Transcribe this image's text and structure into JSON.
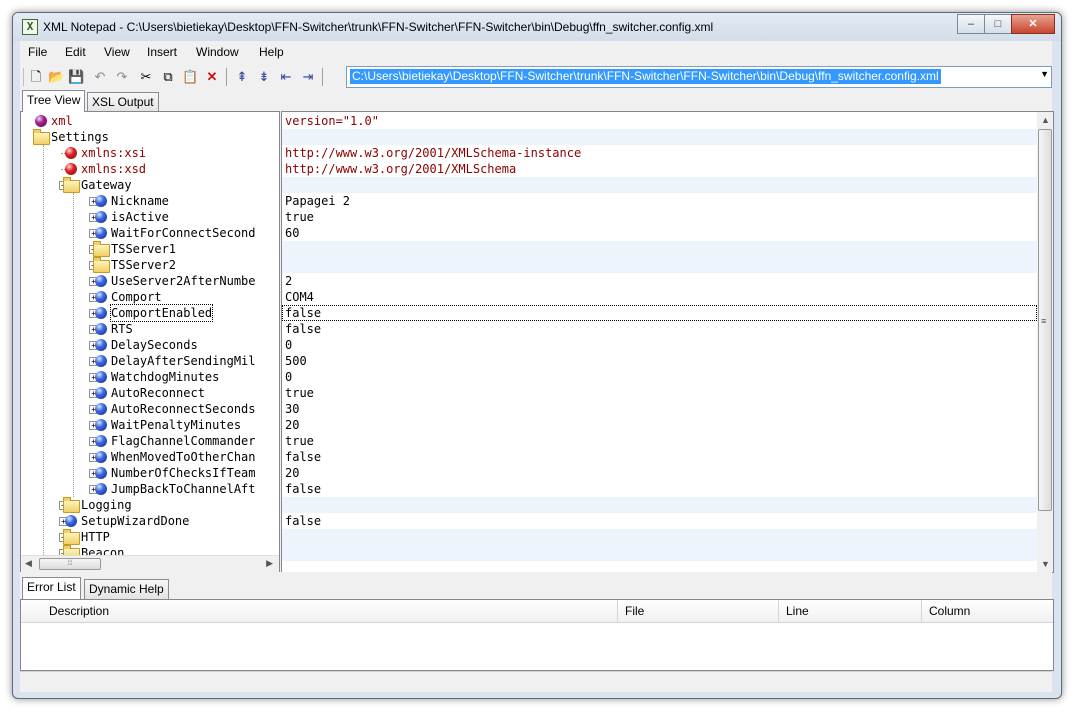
{
  "window": {
    "title": "XML Notepad - C:\\Users\\bietiekay\\Desktop\\FFN-Switcher\\trunk\\FFN-Switcher\\FFN-Switcher\\bin\\Debug\\ffn_switcher.config.xml",
    "app_icon": "X",
    "minimize": "–",
    "maximize": "□",
    "close": "✕"
  },
  "menu": [
    "File",
    "Edit",
    "View",
    "Insert",
    "Window",
    "Help"
  ],
  "toolbar": {
    "icons": [
      "new-file-icon",
      "open-folder-icon",
      "save-icon",
      "undo-icon",
      "redo-icon",
      "cut-icon",
      "copy-icon",
      "paste-icon",
      "delete-icon",
      "nudge-up-icon",
      "nudge-down-icon",
      "nudge-left-icon",
      "nudge-right-icon"
    ],
    "address": "C:\\Users\\bietiekay\\Desktop\\FFN-Switcher\\trunk\\FFN-Switcher\\FFN-Switcher\\bin\\Debug\\ffn_switcher.config.xml"
  },
  "tabs": [
    "Tree View",
    "XSL Output"
  ],
  "tree": [
    {
      "label": "xml",
      "icon": "purple",
      "level": 0,
      "attr": true,
      "value": "version=\"1.0\"",
      "expander": false
    },
    {
      "label": "Settings",
      "icon": "folder",
      "level": 0,
      "attr": false,
      "value": "",
      "expander": false
    },
    {
      "label": "xmlns:xsi",
      "icon": "red",
      "level": 1,
      "attr": true,
      "value": "http://www.w3.org/2001/XMLSchema-instance",
      "expander": false
    },
    {
      "label": "xmlns:xsd",
      "icon": "red",
      "level": 1,
      "attr": true,
      "value": "http://www.w3.org/2001/XMLSchema",
      "expander": false
    },
    {
      "label": "Gateway",
      "icon": "folder",
      "level": 1,
      "attr": false,
      "value": "",
      "expander": "−"
    },
    {
      "label": "Nickname",
      "icon": "blue",
      "level": 2,
      "attr": false,
      "value": "Papagei 2",
      "expander": "+"
    },
    {
      "label": "isActive",
      "icon": "blue",
      "level": 2,
      "attr": false,
      "value": "true",
      "expander": "+"
    },
    {
      "label": "WaitForConnectSecond",
      "icon": "blue",
      "level": 2,
      "attr": false,
      "value": "60",
      "expander": "+"
    },
    {
      "label": "TSServer1",
      "icon": "folder",
      "level": 2,
      "attr": false,
      "value": "",
      "expander": "+"
    },
    {
      "label": "TSServer2",
      "icon": "folder",
      "level": 2,
      "attr": false,
      "value": "",
      "expander": "+"
    },
    {
      "label": "UseServer2AfterNumbe",
      "icon": "blue",
      "level": 2,
      "attr": false,
      "value": "2",
      "expander": "+"
    },
    {
      "label": "Comport",
      "icon": "blue",
      "level": 2,
      "attr": false,
      "value": "COM4",
      "expander": "+"
    },
    {
      "label": "ComportEnabled",
      "icon": "blue",
      "level": 2,
      "attr": false,
      "value": "false",
      "expander": "+",
      "focus": true
    },
    {
      "label": "RTS",
      "icon": "blue",
      "level": 2,
      "attr": false,
      "value": "false",
      "expander": "+"
    },
    {
      "label": "DelaySeconds",
      "icon": "blue",
      "level": 2,
      "attr": false,
      "value": "0",
      "expander": "+"
    },
    {
      "label": "DelayAfterSendingMil",
      "icon": "blue",
      "level": 2,
      "attr": false,
      "value": "500",
      "expander": "+"
    },
    {
      "label": "WatchdogMinutes",
      "icon": "blue",
      "level": 2,
      "attr": false,
      "value": "0",
      "expander": "+"
    },
    {
      "label": "AutoReconnect",
      "icon": "blue",
      "level": 2,
      "attr": false,
      "value": "true",
      "expander": "+"
    },
    {
      "label": "AutoReconnectSeconds",
      "icon": "blue",
      "level": 2,
      "attr": false,
      "value": "30",
      "expander": "+"
    },
    {
      "label": "WaitPenaltyMinutes",
      "icon": "blue",
      "level": 2,
      "attr": false,
      "value": "20",
      "expander": "+"
    },
    {
      "label": "FlagChannelCommander",
      "icon": "blue",
      "level": 2,
      "attr": false,
      "value": "true",
      "expander": "+"
    },
    {
      "label": "WhenMovedToOtherChan",
      "icon": "blue",
      "level": 2,
      "attr": false,
      "value": "false",
      "expander": "+"
    },
    {
      "label": "NumberOfChecksIfTeam",
      "icon": "blue",
      "level": 2,
      "attr": false,
      "value": "20",
      "expander": "+"
    },
    {
      "label": "JumpBackToChannelAft",
      "icon": "blue",
      "level": 2,
      "attr": false,
      "value": "false",
      "expander": "+"
    },
    {
      "label": "Logging",
      "icon": "folder",
      "level": 1,
      "attr": false,
      "value": "",
      "expander": "+"
    },
    {
      "label": "SetupWizardDone",
      "icon": "blue",
      "level": 1,
      "attr": false,
      "value": "false",
      "expander": "+"
    },
    {
      "label": "HTTP",
      "icon": "folder",
      "level": 1,
      "attr": false,
      "value": "",
      "expander": "+"
    },
    {
      "label": "Beacon",
      "icon": "folder",
      "level": 1,
      "attr": false,
      "value": "",
      "expander": "+"
    }
  ],
  "bottom_tabs": [
    "Error List",
    "Dynamic Help"
  ],
  "error_list": {
    "columns": [
      "Description",
      "File",
      "Line",
      "Column"
    ]
  }
}
